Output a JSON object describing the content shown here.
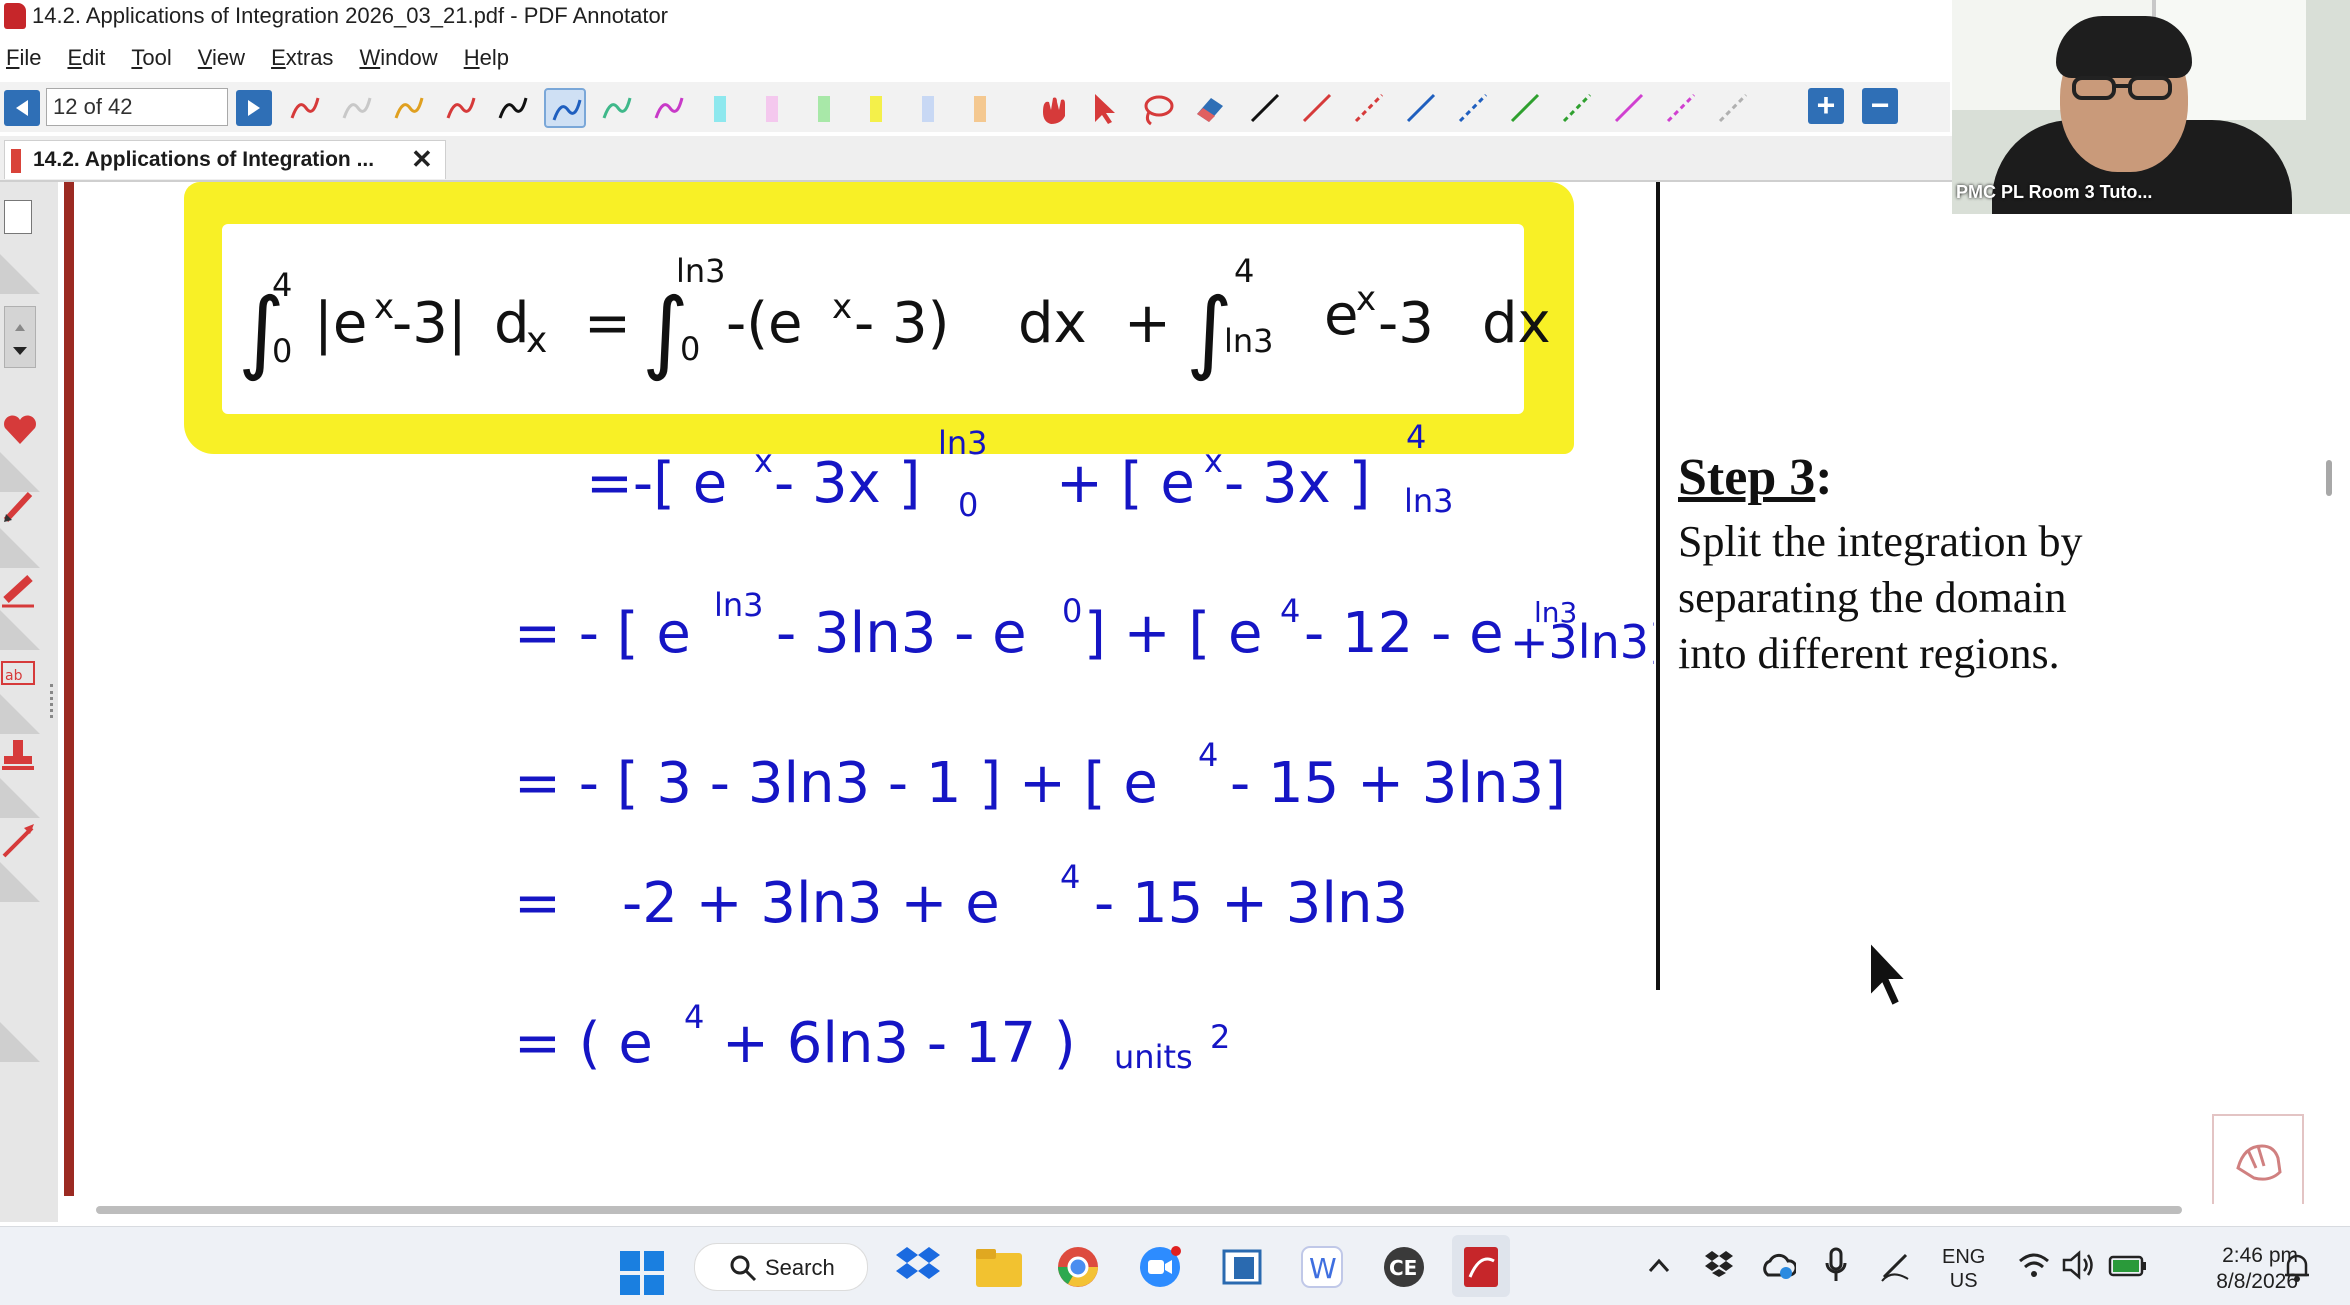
{
  "window": {
    "title": "14.2. Applications of Integration 2026_03_21.pdf - PDF Annotator"
  },
  "menu": {
    "items": [
      {
        "u": "F",
        "rest": "ile"
      },
      {
        "u": "E",
        "rest": "dit"
      },
      {
        "u": "T",
        "rest": "ool"
      },
      {
        "u": "V",
        "rest": "iew"
      },
      {
        "u": "E",
        "rest": "xtras"
      },
      {
        "u": "W",
        "rest": "indow"
      },
      {
        "u": "H",
        "rest": "elp"
      }
    ]
  },
  "toolbar": {
    "page_field": "12 of 42",
    "pen_colors": [
      "#d63a3a",
      "#c8c8c8",
      "#e0a020",
      "#d63a3a",
      "#111111",
      "#1f5fbf",
      "#3fb88a",
      "#c83ac8"
    ],
    "highlighter_colors": [
      "#8ee8ee",
      "#f4c8ee",
      "#a8e8a8",
      "#f4f04a",
      "#c8d8f4",
      "#f4c890"
    ],
    "line_colors": [
      "#111111",
      "#d63a3a",
      "#d63a3a",
      "#1f5fbf",
      "#1f5fbf",
      "#2fa02f",
      "#2fa02f",
      "#d040d0",
      "#d040d0",
      "#b0b0b0"
    ],
    "zoom_in": "+",
    "zoom_out": "−"
  },
  "tab": {
    "label": "14.2. Applications of Integration ...",
    "close": "✕"
  },
  "webcam": {
    "label": "PMC PL Room 3 Tuto..."
  },
  "step": {
    "heading_word": "Step 3",
    "heading_colon": ":",
    "lines": [
      "Split the integration by",
      "separating the domain",
      "into different regions."
    ]
  },
  "taskbar": {
    "search": "Search",
    "lang_top": "ENG",
    "lang_bottom": "US",
    "time": "2:46 pm",
    "date": "8/8/2026"
  },
  "colors": {
    "ink_blue": "#1515c4",
    "highlight_yellow": "#f8f026",
    "accent_blue": "#2f6fb6"
  }
}
